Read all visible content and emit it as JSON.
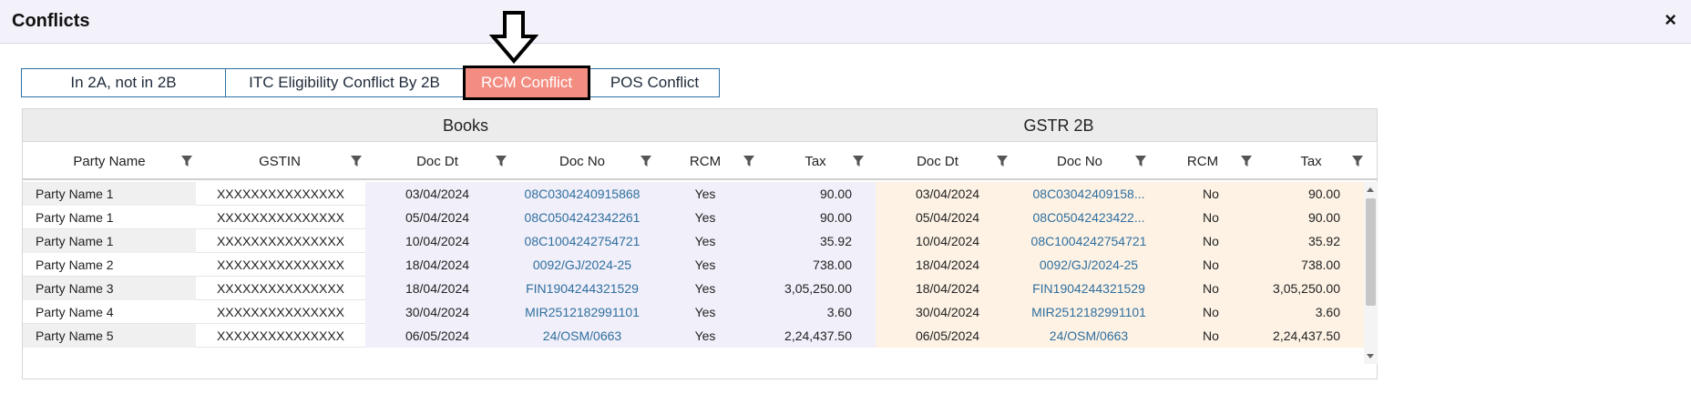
{
  "dialog": {
    "title": "Conflicts",
    "close_icon": "×"
  },
  "tabs": [
    {
      "label": "In 2A, not in 2B",
      "active": false
    },
    {
      "label": "ITC Eligibility Conflict By 2B",
      "active": false
    },
    {
      "label": "RCM Conflict",
      "active": true
    },
    {
      "label": "POS Conflict",
      "active": false
    }
  ],
  "annotation": {
    "icon": "down-arrow-icon"
  },
  "grid": {
    "groups": {
      "books": "Books",
      "gstr2b": "GSTR 2B"
    },
    "columns": [
      "Party Name",
      "GSTIN",
      "Doc Dt",
      "Doc No",
      "RCM",
      "Tax",
      "Doc Dt",
      "Doc No",
      "RCM",
      "Tax"
    ],
    "rows": [
      [
        "Party Name 1",
        "XXXXXXXXXXXXXXX",
        "03/04/2024",
        "08C0304240915868",
        "Yes",
        "90.00",
        "03/04/2024",
        "08C03042409158...",
        "No",
        "90.00"
      ],
      [
        "Party Name 1",
        "XXXXXXXXXXXXXXX",
        "05/04/2024",
        "08C0504242342261",
        "Yes",
        "90.00",
        "05/04/2024",
        "08C05042423422...",
        "No",
        "90.00"
      ],
      [
        "Party Name 1",
        "XXXXXXXXXXXXXXX",
        "10/04/2024",
        "08C1004242754721",
        "Yes",
        "35.92",
        "10/04/2024",
        "08C1004242754721",
        "No",
        "35.92"
      ],
      [
        "Party Name 2",
        "XXXXXXXXXXXXXXX",
        "18/04/2024",
        "0092/GJ/2024-25",
        "Yes",
        "738.00",
        "18/04/2024",
        "0092/GJ/2024-25",
        "No",
        "738.00"
      ],
      [
        "Party Name 3",
        "XXXXXXXXXXXXXXX",
        "18/04/2024",
        "FIN1904244321529",
        "Yes",
        "3,05,250.00",
        "18/04/2024",
        "FIN1904244321529",
        "No",
        "3,05,250.00"
      ],
      [
        "Party Name 4",
        "XXXXXXXXXXXXXXX",
        "30/04/2024",
        "MIR2512182991101",
        "Yes",
        "3.60",
        "30/04/2024",
        "MIR2512182991101",
        "No",
        "3.60"
      ],
      [
        "Party Name 5",
        "XXXXXXXXXXXXXXX",
        "06/05/2024",
        "24/OSM/0663",
        "Yes",
        "2,24,437.50",
        "06/05/2024",
        "24/OSM/0663",
        "No",
        "2,24,437.50"
      ]
    ]
  }
}
